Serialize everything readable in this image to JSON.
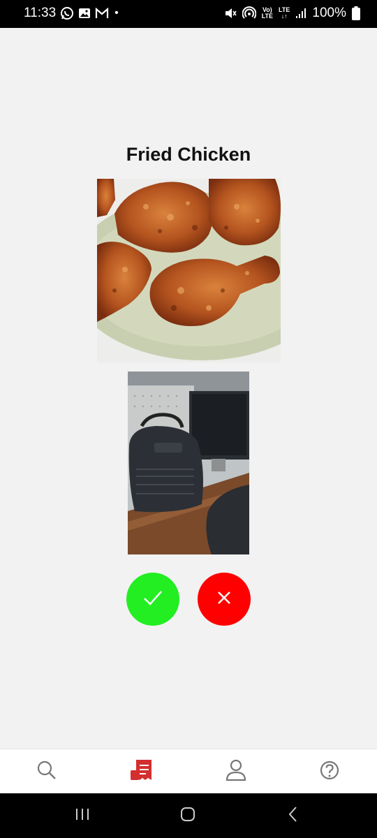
{
  "status_bar": {
    "time": "11:33",
    "battery": "100%",
    "left_icons": [
      "whatsapp-icon",
      "gallery-icon",
      "gmail-icon",
      "notification-dot"
    ],
    "right_icons": [
      "mute-icon",
      "hotspot-icon",
      "volte-icon",
      "lte-icon",
      "signal-icon",
      "battery-icon"
    ],
    "volte_label": "Vo)",
    "volte_sub": "LTE",
    "lte_label": "LTE"
  },
  "dish": {
    "title": "Fried Chicken"
  },
  "actions": {
    "accept_color": "#22ee22",
    "reject_color": "#ff0000"
  },
  "bottom_nav": {
    "items": [
      {
        "icon": "search-icon",
        "active": false
      },
      {
        "icon": "receipt-icon",
        "active": true
      },
      {
        "icon": "profile-icon",
        "active": false
      },
      {
        "icon": "help-icon",
        "active": false
      }
    ],
    "active_color": "#d32f2f",
    "inactive_color": "#777777"
  },
  "system_nav": {
    "items": [
      "recent-apps-icon",
      "home-icon",
      "back-icon"
    ]
  }
}
